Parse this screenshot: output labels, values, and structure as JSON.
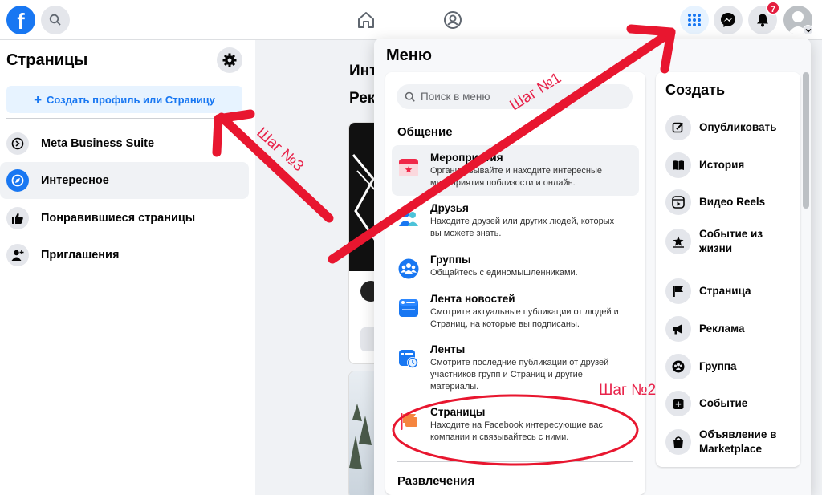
{
  "topbar": {
    "logo_letter": "f",
    "notifications_count": "7",
    "icons": [
      "search-icon",
      "home-icon",
      "friends-icon",
      "menu-grid-icon",
      "messenger-icon",
      "bell-icon",
      "profile-avatar"
    ]
  },
  "sidebar": {
    "title": "Страницы",
    "create_label": "Создать профиль или Страницу",
    "items": [
      {
        "label": "Meta Business Suite"
      },
      {
        "label": "Интересное"
      },
      {
        "label": "Понравившиеся страницы"
      },
      {
        "label": "Приглашения"
      }
    ]
  },
  "feed": {
    "line1": "Инт",
    "line2": "Рек"
  },
  "menu": {
    "title": "Меню",
    "search_placeholder": "Поиск в меню",
    "section_social": "Общение",
    "section_entertainment": "Развлечения",
    "items": [
      {
        "title": "Мероприятия",
        "desc1": "Организовывайте и находите интересные",
        "desc2": "мероприятия поблизости и онлайн."
      },
      {
        "title": "Друзья",
        "desc1": "Находите друзей или других людей, которых",
        "desc2": "вы можете знать."
      },
      {
        "title": "Группы",
        "desc1": "Общайтесь с единомышленниками."
      },
      {
        "title": "Лента новостей",
        "desc1": "Смотрите актуальные публикации от людей и",
        "desc2": "Страниц, на которые вы подписаны."
      },
      {
        "title": "Ленты",
        "desc1": "Смотрите последние публикации от друзей",
        "desc2": "участников групп и Страниц и другие",
        "desc3": "материалы."
      },
      {
        "title": "Страницы",
        "desc1": "Находите на Facebook интересующие вас",
        "desc2": "компании и связывайтесь с ними."
      }
    ]
  },
  "create": {
    "title": "Создать",
    "items": [
      {
        "label": "Опубликовать"
      },
      {
        "label": "История"
      },
      {
        "label": "Видео Reels"
      },
      {
        "label1": "Событие из",
        "label2": "жизни"
      },
      {
        "label": "Страница"
      },
      {
        "label": "Реклама"
      },
      {
        "label": "Группа"
      },
      {
        "label": "Событие"
      },
      {
        "label1": "Объявление в",
        "label2": "Marketplace"
      }
    ]
  },
  "annotations": {
    "step1": "Шаг №1",
    "step2": "Шаг №2",
    "step3": "Шаг №3",
    "color": "#e8234a"
  },
  "colors": {
    "brand": "#1877f2",
    "badge": "#e41e3f"
  }
}
